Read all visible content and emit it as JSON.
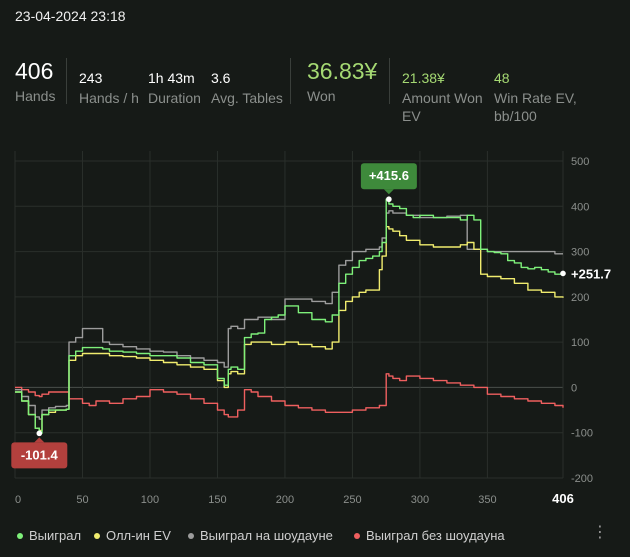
{
  "header": {
    "datetime": "23-04-2024 23:18"
  },
  "stats": {
    "hands": {
      "value": "406",
      "label": "Hands"
    },
    "hands_per_h": {
      "value": "243",
      "label": "Hands / h"
    },
    "duration": {
      "value": "1h 43m",
      "label": "Duration"
    },
    "avg_tables": {
      "value": "3.6",
      "label": "Avg. Tables"
    },
    "won": {
      "value": "36.83¥",
      "label": "Won"
    },
    "amount_won_ev": {
      "value": "21.38¥",
      "label_line1": "Amount Won",
      "label_line2": "EV"
    },
    "win_rate_ev": {
      "value": "48",
      "label_line1": "Win Rate EV,",
      "label_line2": "bb/100"
    }
  },
  "legend": [
    {
      "label": "Выиграл",
      "color": "#7ef07a"
    },
    {
      "label": "Олл-ин EV",
      "color": "#f0ec6e"
    },
    {
      "label": "Выиграл на шоудауне",
      "color": "#9c9c9c"
    },
    {
      "label": "Выиграл без шоудауна",
      "color": "#ef5f5f"
    }
  ],
  "colors": {
    "won": "#a5d973",
    "max_badge": "#3e8a3b",
    "min_badge": "#b3403d"
  },
  "chart_data": {
    "type": "line",
    "xlim": [
      0,
      406
    ],
    "ylim": [
      -200,
      500
    ],
    "xticks": [
      0,
      50,
      100,
      150,
      200,
      250,
      300,
      350
    ],
    "xtick_last": "406",
    "yticks": [
      500,
      400,
      300,
      200,
      100,
      0,
      -100,
      -200
    ],
    "grid": true,
    "legend_position": "bottom",
    "annotations": {
      "max": {
        "label": "+415.6",
        "x": 277,
        "y": 415.6
      },
      "min": {
        "label": "-101.4",
        "x": 18,
        "y": -101.4
      },
      "end": {
        "label": "+251.7",
        "x": 406,
        "y": 251.7
      }
    },
    "series": [
      {
        "name": "Выиграл",
        "color": "#7ef07a",
        "x": [
          0,
          5,
          10,
          15,
          18,
          20,
          25,
          30,
          35,
          38,
          40,
          45,
          50,
          60,
          65,
          70,
          80,
          90,
          100,
          110,
          120,
          130,
          140,
          150,
          155,
          158,
          160,
          165,
          170,
          175,
          180,
          185,
          190,
          195,
          200,
          210,
          220,
          230,
          235,
          240,
          245,
          250,
          255,
          260,
          265,
          270,
          272,
          275,
          277,
          280,
          285,
          290,
          295,
          300,
          310,
          320,
          330,
          335,
          340,
          345,
          350,
          355,
          360,
          365,
          370,
          375,
          380,
          385,
          390,
          395,
          400,
          406
        ],
        "y": [
          -10,
          -30,
          -60,
          -90,
          -101.4,
          -60,
          -50,
          -50,
          -50,
          -48,
          70,
          80,
          88,
          88,
          85,
          80,
          78,
          75,
          70,
          70,
          65,
          55,
          50,
          20,
          5,
          40,
          45,
          40,
          110,
          118,
          120,
          150,
          155,
          160,
          180,
          165,
          150,
          145,
          160,
          230,
          250,
          265,
          280,
          285,
          290,
          300,
          320,
          415.6,
          405,
          400,
          395,
          380,
          375,
          380,
          375,
          375,
          370,
          380,
          370,
          305,
          300,
          298,
          295,
          280,
          275,
          265,
          262,
          265,
          260,
          255,
          250,
          251.7
        ]
      },
      {
        "name": "Олл-ин EV",
        "color": "#f0ec6e",
        "x": [
          0,
          5,
          10,
          15,
          18,
          20,
          25,
          30,
          35,
          38,
          40,
          45,
          50,
          60,
          70,
          80,
          90,
          100,
          110,
          120,
          130,
          140,
          150,
          155,
          158,
          160,
          165,
          170,
          175,
          180,
          190,
          200,
          210,
          220,
          230,
          235,
          240,
          245,
          250,
          255,
          260,
          270,
          272,
          275,
          277,
          280,
          285,
          290,
          300,
          310,
          320,
          330,
          335,
          340,
          345,
          350,
          360,
          370,
          380,
          390,
          400,
          406
        ],
        "y": [
          -10,
          -30,
          -60,
          -90,
          -95,
          -60,
          -55,
          -50,
          -50,
          -48,
          60,
          70,
          75,
          75,
          70,
          68,
          65,
          60,
          55,
          50,
          45,
          40,
          15,
          0,
          30,
          35,
          30,
          95,
          100,
          100,
          95,
          100,
          95,
          90,
          85,
          100,
          170,
          190,
          200,
          210,
          215,
          260,
          290,
          355,
          350,
          345,
          335,
          325,
          315,
          310,
          310,
          315,
          320,
          305,
          250,
          245,
          240,
          230,
          215,
          210,
          200,
          198
        ]
      },
      {
        "name": "Выиграл на шоудауне",
        "color": "#9c9c9c",
        "x": [
          0,
          5,
          10,
          15,
          18,
          20,
          25,
          30,
          35,
          38,
          40,
          45,
          50,
          60,
          65,
          70,
          80,
          90,
          100,
          110,
          120,
          130,
          140,
          150,
          155,
          158,
          160,
          165,
          170,
          180,
          190,
          200,
          210,
          220,
          230,
          235,
          240,
          245,
          250,
          255,
          260,
          270,
          272,
          275,
          277,
          280,
          290,
          300,
          310,
          320,
          330,
          335,
          340,
          350,
          360,
          370,
          380,
          390,
          400,
          406
        ],
        "y": [
          -5,
          -20,
          -40,
          -65,
          -70,
          -50,
          -45,
          -42,
          -42,
          -40,
          100,
          110,
          130,
          130,
          100,
          95,
          90,
          85,
          80,
          78,
          70,
          65,
          60,
          55,
          45,
          130,
          135,
          130,
          150,
          155,
          150,
          195,
          195,
          190,
          185,
          210,
          270,
          280,
          300,
          300,
          305,
          310,
          330,
          385,
          390,
          385,
          380,
          375,
          375,
          378,
          380,
          305,
          305,
          300,
          300,
          300,
          300,
          300,
          295,
          295
        ]
      },
      {
        "name": "Выиграл без шоудауна",
        "color": "#ef5f5f",
        "x": [
          0,
          5,
          10,
          15,
          18,
          20,
          25,
          30,
          40,
          50,
          55,
          60,
          70,
          80,
          90,
          100,
          110,
          120,
          130,
          140,
          150,
          155,
          158,
          160,
          165,
          170,
          175,
          180,
          190,
          200,
          210,
          220,
          230,
          240,
          250,
          260,
          270,
          275,
          277,
          280,
          285,
          290,
          300,
          310,
          320,
          330,
          340,
          350,
          360,
          370,
          380,
          390,
          400,
          406
        ],
        "y": [
          0,
          -5,
          -10,
          -18,
          -20,
          -15,
          -10,
          -10,
          -25,
          -35,
          -40,
          -30,
          -35,
          -25,
          -20,
          -5,
          -10,
          -15,
          -25,
          -35,
          -50,
          -60,
          -65,
          -65,
          -50,
          -5,
          -10,
          -20,
          -30,
          -40,
          -45,
          -50,
          -55,
          -55,
          -50,
          -45,
          -40,
          30,
          25,
          20,
          15,
          25,
          20,
          15,
          10,
          5,
          0,
          -15,
          -20,
          -25,
          -30,
          -35,
          -40,
          -45
        ]
      }
    ]
  }
}
